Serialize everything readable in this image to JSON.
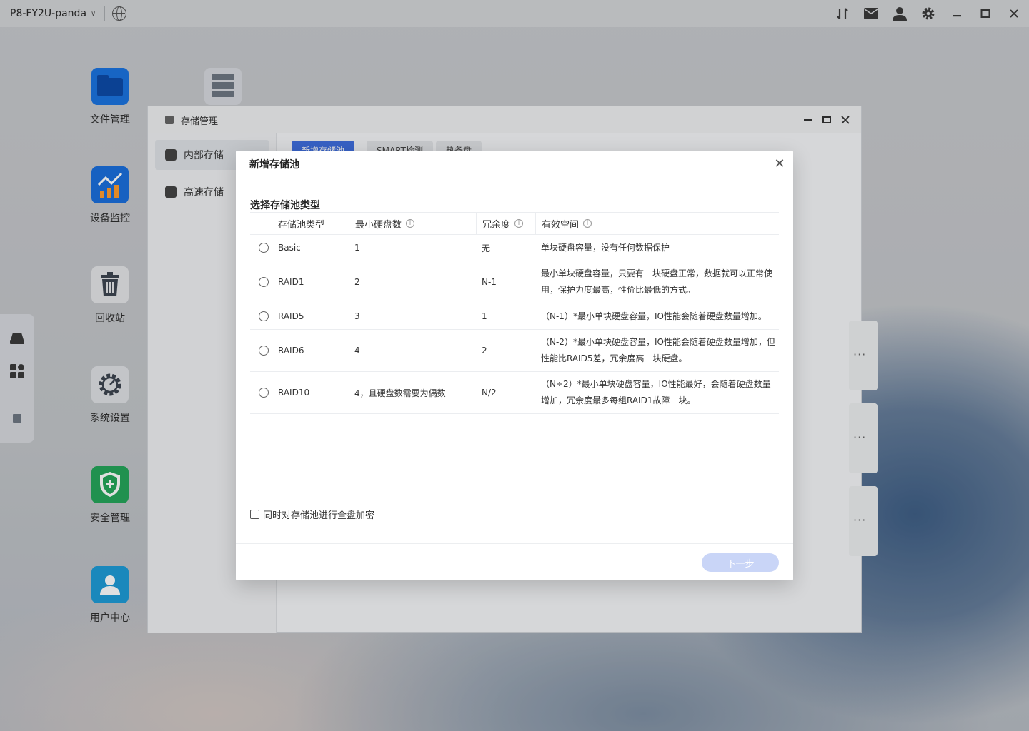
{
  "topbar": {
    "host": "P8-FY2U-panda",
    "icons": [
      "network-arrows-icon",
      "mail-icon",
      "user-icon",
      "gear-icon",
      "minimize-icon",
      "maximize-icon",
      "close-icon"
    ]
  },
  "desktop": {
    "icons": [
      {
        "label": "文件管理",
        "icon": "folder-icon"
      },
      {
        "label": "设备监控",
        "icon": "chart-icon"
      },
      {
        "label": "回收站",
        "icon": "trash-icon"
      },
      {
        "label": "系统设置",
        "icon": "settings-icon"
      },
      {
        "label": "安全管理",
        "icon": "shield-icon"
      },
      {
        "label": "用户中心",
        "icon": "user-icon"
      }
    ]
  },
  "window": {
    "title": "存储管理",
    "sidebar": [
      {
        "label": "内部存储",
        "active": true
      },
      {
        "label": "高速存储",
        "active": false
      }
    ],
    "tabs": [
      "新增存储池",
      "SMART检测",
      "热备盘"
    ]
  },
  "modal": {
    "title": "新增存储池",
    "section_title": "选择存储池类型",
    "columns": [
      "存储池类型",
      "最小硬盘数",
      "冗余度",
      "有效空间"
    ],
    "rows": [
      {
        "type": "Basic",
        "min_disks": "1",
        "redundancy": "无",
        "space": "单块硬盘容量，没有任何数据保护"
      },
      {
        "type": "RAID1",
        "min_disks": "2",
        "redundancy": "N-1",
        "space": "最小单块硬盘容量，只要有一块硬盘正常，数据就可以正常使用，保护力度最高，性价比最低的方式。"
      },
      {
        "type": "RAID5",
        "min_disks": "3",
        "redundancy": "1",
        "space": "（N-1）*最小单块硬盘容量，IO性能会随着硬盘数量增加。"
      },
      {
        "type": "RAID6",
        "min_disks": "4",
        "redundancy": "2",
        "space": "（N-2）*最小单块硬盘容量，IO性能会随着硬盘数量增加，但性能比RAID5差，冗余度高一块硬盘。"
      },
      {
        "type": "RAID10",
        "min_disks": "4，且硬盘数需要为偶数",
        "redundancy": "N/2",
        "space": "（N÷2）*最小单块硬盘容量，IO性能最好，会随着硬盘数量增加，冗余度最多每组RAID1故障一块。"
      }
    ],
    "encrypt_label": "同时对存储池进行全盘加密",
    "next_label": "下一步"
  }
}
